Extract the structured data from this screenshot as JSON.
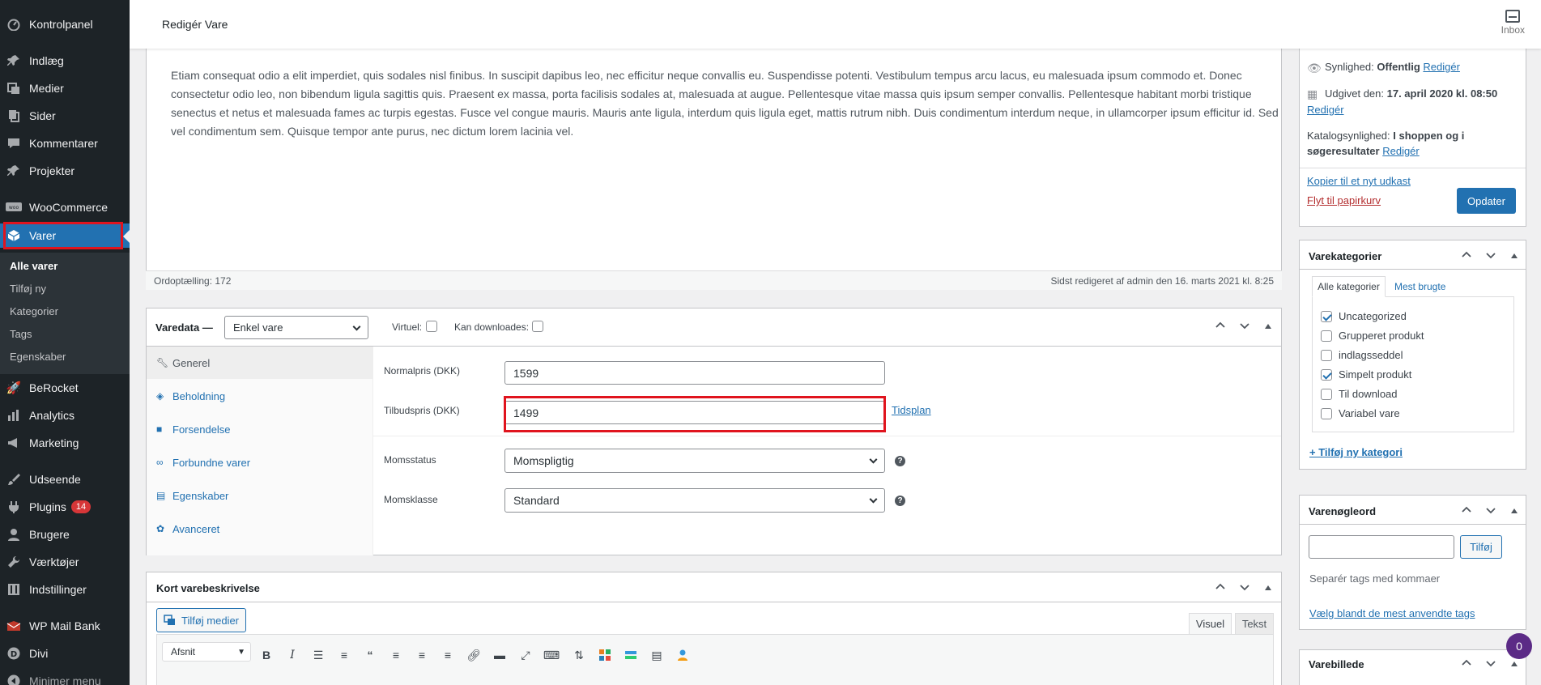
{
  "sidebar": {
    "items": [
      {
        "label": "Kontrolpanel",
        "icon": "dashboard-icon"
      },
      {
        "label": "Indlæg",
        "icon": "pin-icon"
      },
      {
        "label": "Medier",
        "icon": "media-icon"
      },
      {
        "label": "Sider",
        "icon": "page-icon"
      },
      {
        "label": "Kommentarer",
        "icon": "comment-icon"
      },
      {
        "label": "Projekter",
        "icon": "pin-icon"
      },
      {
        "label": "WooCommerce",
        "icon": "woo-icon"
      },
      {
        "label": "Varer",
        "icon": "product-icon"
      },
      {
        "label": "BeRocket",
        "icon": "rocket-icon"
      },
      {
        "label": "Analytics",
        "icon": "bar-chart-icon"
      },
      {
        "label": "Marketing",
        "icon": "megaphone-icon"
      },
      {
        "label": "Udseende",
        "icon": "brush-icon"
      },
      {
        "label": "Plugins",
        "icon": "plugin-icon",
        "badge": "14"
      },
      {
        "label": "Brugere",
        "icon": "user-icon"
      },
      {
        "label": "Værktøjer",
        "icon": "wrench-icon"
      },
      {
        "label": "Indstillinger",
        "icon": "settings-icon"
      },
      {
        "label": "WP Mail Bank",
        "icon": "mail-icon"
      },
      {
        "label": "Divi",
        "icon": "divi-icon"
      },
      {
        "label": "Minimer menu",
        "icon": "collapse-icon"
      }
    ],
    "submenu": [
      "Alle varer",
      "Tilføj ny",
      "Kategorier",
      "Tags",
      "Egenskaber"
    ]
  },
  "header": {
    "title": "Redigér Vare",
    "inbox_label": "Inbox"
  },
  "editor": {
    "text": "Etiam consequat odio a elit imperdiet, quis sodales nisl finibus. In suscipit dapibus leo, nec efficitur neque convallis eu. Suspendisse potenti. Vestibulum tempus arcu lacus, eu malesuada ipsum commodo et. Donec consectetur odio leo, non bibendum ligula sagittis quis. Praesent ex massa, porta facilisis sodales at, malesuada at augue. Pellentesque vitae massa quis ipsum semper convallis. Pellentesque habitant morbi tristique senectus et netus et malesuada fames ac turpis egestas. Fusce vel congue mauris. Mauris ante ligula, interdum quis ligula eget, mattis rutrum nibh. Duis condimentum interdum neque, in ullamcorper ipsum efficitur id. Sed vel condimentum sem. Quisque tempor ante purus, nec dictum lorem lacinia vel.",
    "word_count": "Ordoptælling: 172",
    "last_edited": "Sidst redigeret af admin den 16. marts 2021 kl. 8:25"
  },
  "product_data": {
    "title": "Varedata —",
    "type_value": "Enkel vare",
    "virtual_label": "Virtuel:",
    "downloadable_label": "Kan downloades:",
    "tabs": [
      "Generel",
      "Beholdning",
      "Forsendelse",
      "Forbundne varer",
      "Egenskaber",
      "Avanceret"
    ],
    "regular_price_label": "Normalpris (DKK)",
    "regular_price": "1599",
    "sale_price_label": "Tilbudspris (DKK)",
    "sale_price": "1499",
    "schedule_link": "Tidsplan",
    "tax_status_label": "Momsstatus",
    "tax_status": "Momspligtig",
    "tax_class_label": "Momsklasse",
    "tax_class": "Standard",
    "help_glyph": "?"
  },
  "short_desc": {
    "title": "Kort varebeskrivelse",
    "add_media": "Tilføj medier",
    "tab_visual": "Visuel",
    "tab_text": "Tekst",
    "format_value": "Afsnit"
  },
  "publish": {
    "visibility_label": "Synlighed:",
    "visibility_value": "Offentlig",
    "edit": "Redigér",
    "published_label": "Udgivet den:",
    "published_value": "17. april 2020 kl. 08:50",
    "published_edit": "Redigér",
    "catalog_label": "Katalogsynlighed:",
    "catalog_value": "I shoppen og i",
    "catalog_value_2": "søgeresultater",
    "catalog_edit": "Redigér",
    "copy_draft": "Kopier til et nyt udkast",
    "trash": "Flyt til papirkurv",
    "update": "Opdater"
  },
  "categories": {
    "title": "Varekategorier",
    "tab_all": "Alle kategorier",
    "tab_most": "Mest brugte",
    "items": [
      {
        "label": "Uncategorized",
        "checked": true
      },
      {
        "label": "Grupperet produkt",
        "checked": false
      },
      {
        "label": "indlagsseddel",
        "checked": false
      },
      {
        "label": "Simpelt produkt",
        "checked": true
      },
      {
        "label": "Til download",
        "checked": false
      },
      {
        "label": "Variabel vare",
        "checked": false
      }
    ],
    "add_new": "+ Tilføj ny kategori"
  },
  "tags": {
    "title": "Varenøgleord",
    "add_button": "Tilføj",
    "hint": "Separér tags med kommaer",
    "choose_link": "Vælg blandt de mest anvendte tags"
  },
  "image_box": {
    "title": "Varebillede"
  },
  "floating_badge": "0",
  "colors": {
    "accent": "#2271b1",
    "highlight": "#e0141e",
    "sidebar": "#1d2327"
  }
}
